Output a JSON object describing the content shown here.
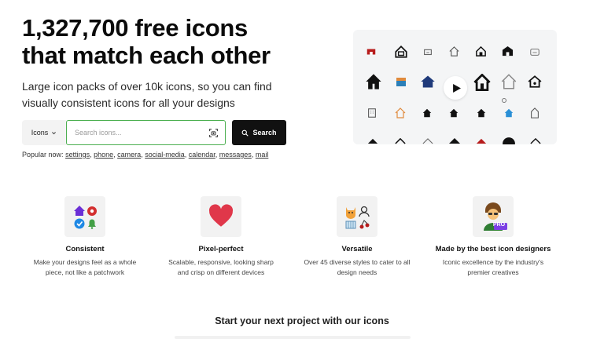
{
  "hero": {
    "title_line1": "1,327,700 free icons",
    "title_line2": "that match each other",
    "subtitle_line1": "Large icon packs of over 10k icons, so you can find",
    "subtitle_line2": "visually consistent icons for all your designs"
  },
  "search": {
    "type_label": "Icons",
    "placeholder": "Search icons...",
    "button_label": "Search"
  },
  "popular": {
    "label": "Popular now:",
    "items": [
      "settings",
      "phone",
      "camera",
      "social-media",
      "calendar",
      "messages",
      "mail"
    ]
  },
  "features": [
    {
      "title": "Consistent",
      "desc_line1": "Make your designs feel as a whole",
      "desc_line2": "piece, not like a patchwork"
    },
    {
      "title": "Pixel-perfect",
      "desc_line1": "Scalable, responsive, looking sharp",
      "desc_line2": "and crisp on different devices"
    },
    {
      "title": "Versatile",
      "desc_line1": "Over 45 diverse styles to cater to all",
      "desc_line2": "design needs"
    },
    {
      "title": "Made by the best icon designers",
      "desc_line1": "Iconic excellence by the industry's",
      "desc_line2": "premier creatives"
    }
  ],
  "pro_badge": "PRO",
  "bottom": {
    "heading": "Start your next project with our icons"
  },
  "colors": {
    "accent_green": "#4caf50",
    "dark": "#111111",
    "heart_red": "#e0374a",
    "purple": "#6b2fd6",
    "blue": "#1e88e5",
    "pro_purple": "#7b3fe4"
  }
}
